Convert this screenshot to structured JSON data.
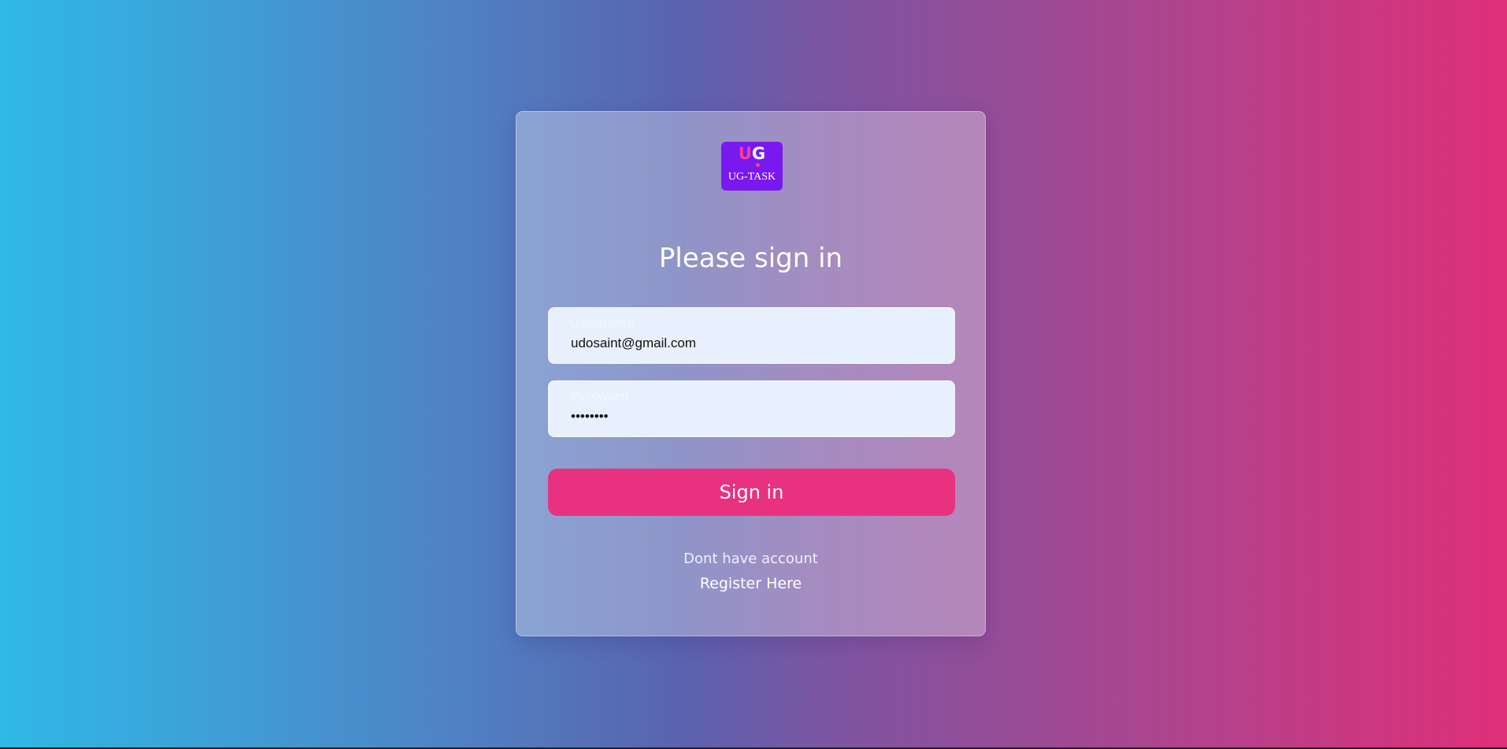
{
  "logo": {
    "mark_u": "U",
    "mark_g": "G",
    "text": "UG-TASK"
  },
  "form": {
    "title": "Please sign in",
    "username": {
      "label": "Username",
      "value": "udosaint@gmail.com"
    },
    "password": {
      "label": "Password",
      "value": "••••••••"
    },
    "submit_label": "Sign in"
  },
  "footer": {
    "prompt": "Dont have account",
    "register_label": "Register Here"
  },
  "colors": {
    "gradient_left": "#2fb9e6",
    "gradient_right": "#de2f78",
    "button": "#e8327f",
    "logo_bg": "#7a18f0",
    "input_bg": "#e8f0fd"
  }
}
